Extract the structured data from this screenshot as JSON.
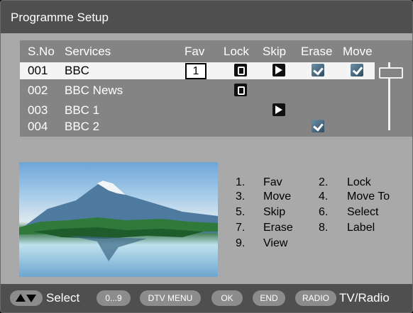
{
  "title": "Programme Setup",
  "columns": {
    "sno": "S.No",
    "services": "Services",
    "fav": "Fav",
    "lock": "Lock",
    "skip": "Skip",
    "erase": "Erase",
    "move": "Move"
  },
  "rows": [
    {
      "sno": "001",
      "service": "BBC",
      "fav": "1",
      "lock": true,
      "skip": true,
      "erase": true,
      "move": true,
      "selected": true
    },
    {
      "sno": "002",
      "service": "BBC News",
      "fav": "",
      "lock": true,
      "skip": false,
      "erase": false,
      "move": false,
      "selected": false
    },
    {
      "sno": "003",
      "service": "BBC 1",
      "fav": "",
      "lock": false,
      "skip": true,
      "erase": false,
      "move": false,
      "selected": false
    },
    {
      "sno": "004",
      "service": "BBC 2",
      "fav": "",
      "lock": false,
      "skip": false,
      "erase": true,
      "move": false,
      "selected": false
    }
  ],
  "icons": {
    "lock": "lock-icon",
    "skip": "skip-icon",
    "erase": "erase-check-icon",
    "move": "move-check-icon"
  },
  "legend": [
    {
      "num": "1.",
      "label": "Fav"
    },
    {
      "num": "2.",
      "label": "Lock"
    },
    {
      "num": "3.",
      "label": "Move"
    },
    {
      "num": "4.",
      "label": "Move To"
    },
    {
      "num": "5.",
      "label": "Skip"
    },
    {
      "num": "6.",
      "label": "Select"
    },
    {
      "num": "7.",
      "label": "Erase"
    },
    {
      "num": "8.",
      "label": "Label"
    },
    {
      "num": "9.",
      "label": "View"
    }
  ],
  "footer": {
    "select_label": "Select",
    "digits_button": "0...9",
    "dtv_menu_button": "DTV MENU",
    "ok_button": "OK",
    "end_button": "END",
    "radio_button": "RADIO",
    "tv_radio_label": "TV/Radio"
  },
  "colors": {
    "title_bar": "#4f4f4f",
    "panel": "#a9a9a9",
    "table": "#848484",
    "selected_row": "#f4f4f4"
  }
}
